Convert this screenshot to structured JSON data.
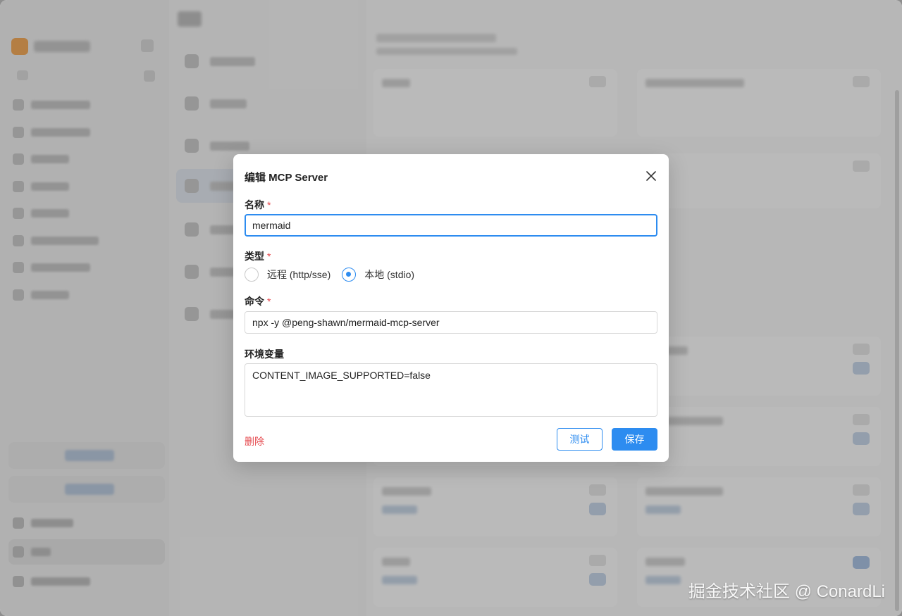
{
  "dialog": {
    "title": "编辑 MCP Server",
    "name_label": "名称",
    "name_value": "mermaid",
    "type_label": "类型",
    "type_options": [
      {
        "label": "远程 (http/sse)",
        "checked": false
      },
      {
        "label": "本地 (stdio)",
        "checked": true
      }
    ],
    "command_label": "命令",
    "command_value": "npx -y @peng-shawn/mermaid-mcp-server",
    "env_label": "环境变量",
    "env_value": "CONTENT_IMAGE_SUPPORTED=false",
    "required_mark": "*",
    "delete_label": "删除",
    "test_label": "测试",
    "save_label": "保存"
  },
  "watermark": "掘金技术社区 @ ConardLi",
  "colors": {
    "accent": "#2d8cf0",
    "danger": "#e5484d"
  }
}
